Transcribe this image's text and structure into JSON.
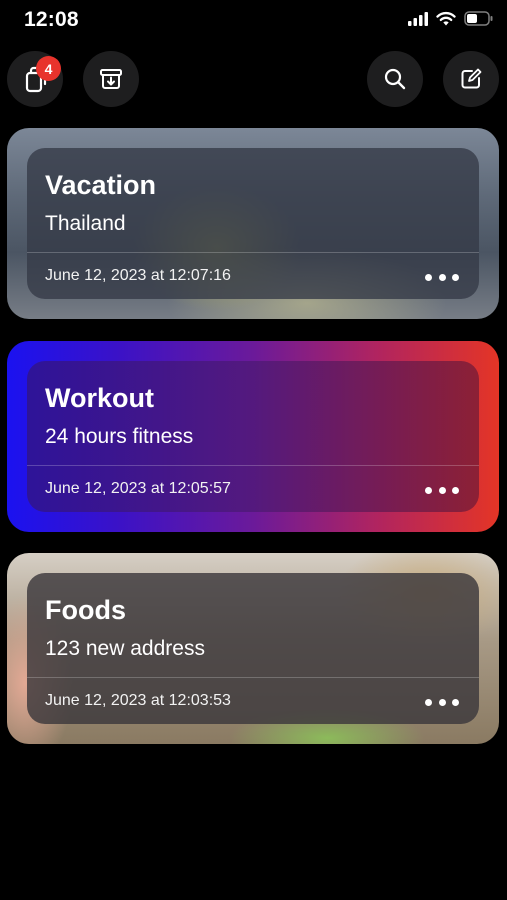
{
  "status_bar": {
    "time": "12:08",
    "icons": [
      "cellular-signal-icon",
      "wifi-icon",
      "battery-icon"
    ]
  },
  "toolbar": {
    "left": [
      {
        "icon": "notes-stack-icon",
        "badge": "4"
      },
      {
        "icon": "archive-icon"
      }
    ],
    "right": [
      {
        "icon": "search-icon"
      },
      {
        "icon": "compose-icon"
      }
    ],
    "badge_color": "#e8332c"
  },
  "cards": [
    {
      "title": "Vacation",
      "subtitle": "Thailand",
      "date": "June 12, 2023 at 12:07:16",
      "more_icon": "ellipsis-icon"
    },
    {
      "title": "Workout",
      "subtitle": "24 hours fitness",
      "date": "June 12, 2023 at 12:05:57",
      "more_icon": "ellipsis-icon"
    },
    {
      "title": "Foods",
      "subtitle": "123 new address",
      "date": "June 12, 2023 at 12:03:53",
      "more_icon": "ellipsis-icon"
    }
  ],
  "colors": {
    "background": "#000000",
    "button_bg": "#1e1e1f",
    "workout_gradient_start": "#1b12f0",
    "workout_gradient_end": "#e43526"
  }
}
